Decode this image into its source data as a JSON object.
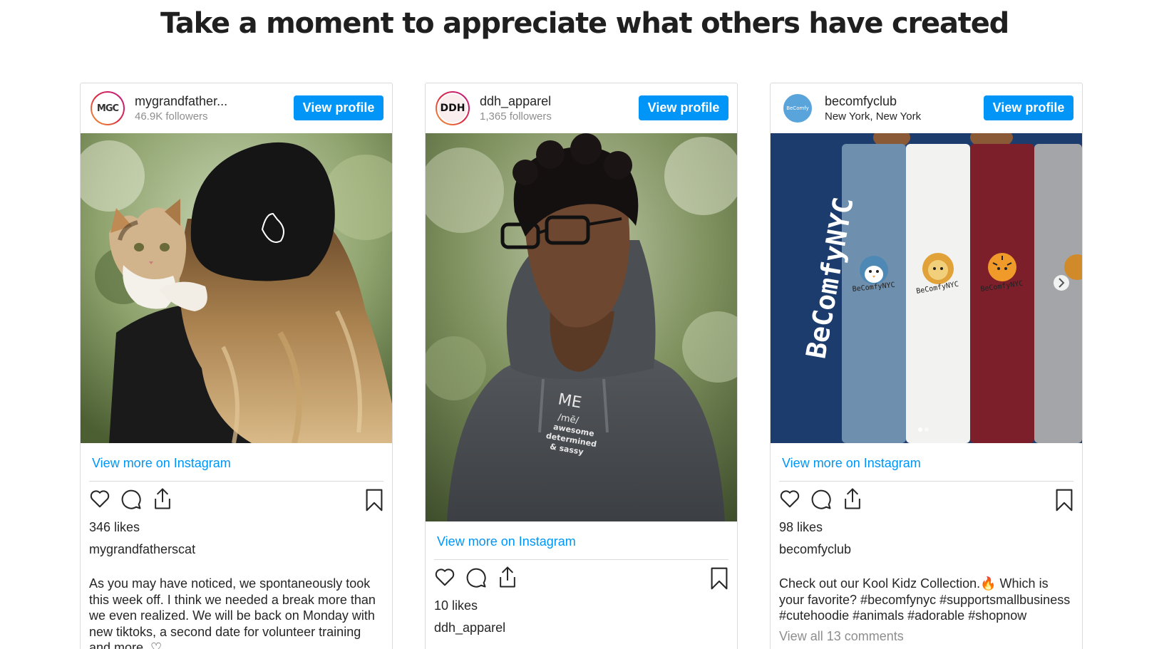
{
  "page": {
    "title": "Take a moment to appreciate what others have created"
  },
  "colors": {
    "accent": "#0095f6",
    "border": "#dbdbdb",
    "muted": "#8e8e8e"
  },
  "posts": [
    {
      "username": "mygrandfather...",
      "subtitle": "46.9K followers",
      "avatar_text": "MGC",
      "view_profile_label": "View profile",
      "view_more_label": "View more on Instagram",
      "likes": "346 likes",
      "caption_user": "mygrandfatherscat",
      "caption": "As you may have noticed, we spontaneously took this week off. I think we needed a break more than we even realized. We will be back on Monday with new tiktoks, a second date for volunteer training and more. ♡",
      "icons": [
        "heart-icon",
        "comment-icon",
        "share-icon",
        "bookmark-icon"
      ]
    },
    {
      "username": "ddh_apparel",
      "subtitle": "1,365 followers",
      "avatar_text": "DDH",
      "view_profile_label": "View profile",
      "photo_print": {
        "l1": "ME",
        "l2": "/mē/",
        "l3": "awesome",
        "l4": "determined",
        "l5": "& sassy"
      },
      "view_more_label": "View more on Instagram",
      "likes": "10 likes",
      "caption_user": "ddh_apparel",
      "icons": [
        "heart-icon",
        "comment-icon",
        "share-icon",
        "bookmark-icon"
      ]
    },
    {
      "username": "becomfyclub",
      "subtitle": "New York, New York",
      "avatar_text": "BeComfy",
      "view_profile_label": "View profile",
      "photo_brand": "BeComfyNYC",
      "patch_text": "BeComfyNYC",
      "view_more_label": "View more on Instagram",
      "likes": "98 likes",
      "caption_user": "becomfyclub",
      "caption": "Check out our Kool Kidz Collection.🔥 Which is your favorite? #becomfynyc #supportsmallbusiness #cutehoodie #animals #adorable #shopnow",
      "comments": "View all 13 comments",
      "icons": [
        "heart-icon",
        "comment-icon",
        "share-icon",
        "bookmark-icon"
      ]
    }
  ]
}
